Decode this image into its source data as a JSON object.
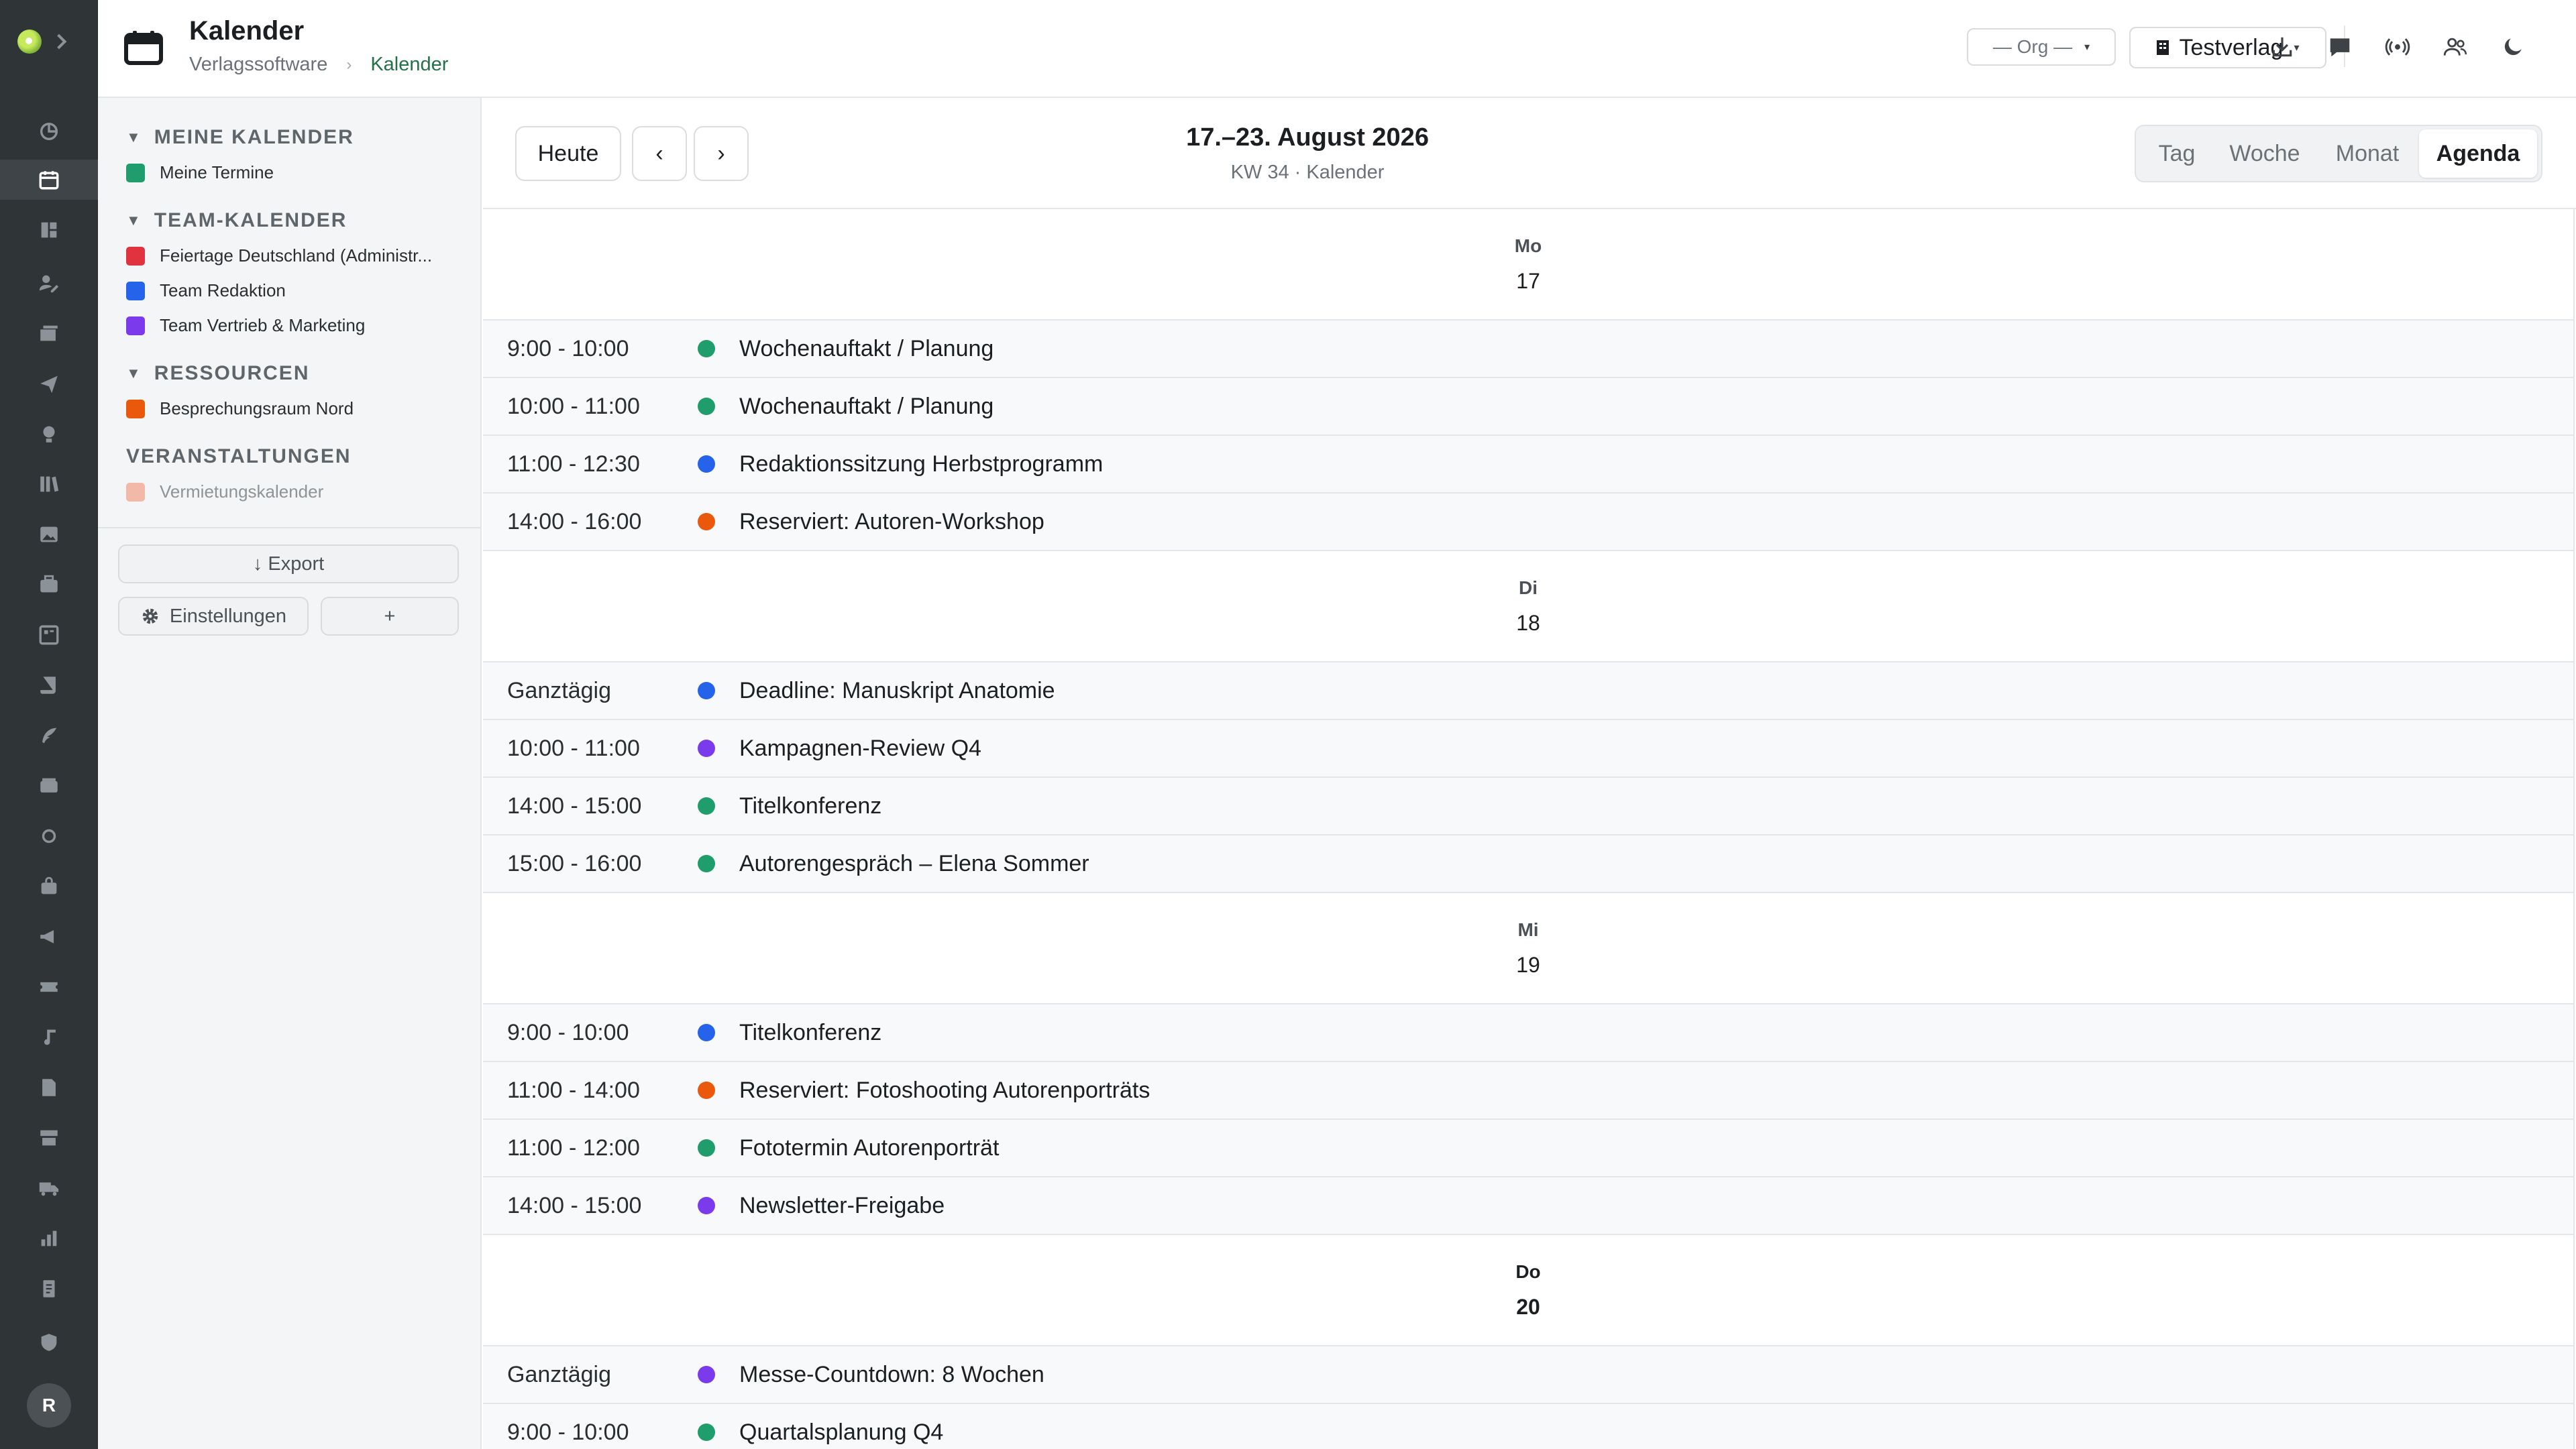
{
  "header": {
    "title": "Kalender",
    "breadcrumb_parent": "Verlagssoftware",
    "breadcrumb_sep": "›",
    "breadcrumb_current": "Kalender",
    "org_select": "— Org —",
    "tenant_select": "Testverlag",
    "caret": "▾",
    "icons": [
      "download-icon",
      "chat-icon",
      "broadcast-icon",
      "users-icon",
      "moon-icon"
    ]
  },
  "rail": {
    "avatar": "R",
    "icons": [
      "chart-pie-icon",
      "calendar-icon",
      "dashboard-icon",
      "user-edit-icon",
      "mail-stack-icon",
      "send-icon",
      "lightbulb-icon",
      "library-icon",
      "image-icon",
      "briefcase-icon",
      "board-icon",
      "scroll-icon",
      "feather-icon",
      "wallet-icon",
      "circle-icon",
      "bag-icon",
      "megaphone-icon",
      "ticket-icon",
      "music-icon",
      "file-icon",
      "store-icon",
      "truck-icon",
      "bar-chart-icon",
      "document-icon",
      "shield-icon"
    ]
  },
  "sidebar": {
    "collapse_glyph": "▼",
    "sections": [
      {
        "title": "MEINE KALENDER",
        "collapsible": true,
        "items": [
          {
            "label": "Meine Termine",
            "color": "#1f9d6c"
          }
        ]
      },
      {
        "title": "TEAM-KALENDER",
        "collapsible": true,
        "items": [
          {
            "label": "Feiertage Deutschland (Administr...",
            "color": "#e0323f"
          },
          {
            "label": "Team Redaktion",
            "color": "#2563eb"
          },
          {
            "label": "Team Vertrieb & Marketing",
            "color": "#7c3aed"
          }
        ]
      },
      {
        "title": "RESSOURCEN",
        "collapsible": true,
        "items": [
          {
            "label": "Besprechungsraum Nord",
            "color": "#ea580c"
          }
        ]
      },
      {
        "title": "VERANSTALTUNGEN",
        "collapsible": false,
        "items": [
          {
            "label": "Vermietungskalender",
            "color": "#f2b8a8"
          }
        ]
      }
    ],
    "export_label": "↓ Export",
    "settings_label": "Einstellungen",
    "add_label": "+"
  },
  "toolbar": {
    "today_label": "Heute",
    "prev_label": "‹",
    "next_label": "›",
    "range_title": "17.–23. August 2026",
    "range_subtitle": "KW 34 · Kalender",
    "views": [
      "Tag",
      "Woche",
      "Monat",
      "Agenda"
    ],
    "active_view": "Agenda"
  },
  "agenda": {
    "days": [
      {
        "dow": "Mo",
        "day": "17",
        "today": false,
        "events": [
          {
            "time": "9:00 - 10:00",
            "title": "Wochenauftakt / Planung",
            "color": "#1f9d6c"
          },
          {
            "time": "10:00 - 11:00",
            "title": "Wochenauftakt / Planung",
            "color": "#1f9d6c"
          },
          {
            "time": "11:00 - 12:30",
            "title": "Redaktionssitzung Herbstprogramm",
            "color": "#2563eb"
          },
          {
            "time": "14:00 - 16:00",
            "title": "Reserviert: Autoren-Workshop",
            "color": "#ea580c"
          }
        ]
      },
      {
        "dow": "Di",
        "day": "18",
        "today": false,
        "events": [
          {
            "time": "Ganztägig",
            "title": "Deadline: Manuskript Anatomie",
            "color": "#2563eb"
          },
          {
            "time": "10:00 - 11:00",
            "title": "Kampagnen-Review Q4",
            "color": "#7c3aed"
          },
          {
            "time": "14:00 - 15:00",
            "title": "Titelkonferenz",
            "color": "#1f9d6c"
          },
          {
            "time": "15:00 - 16:00",
            "title": "Autorengespräch – Elena Sommer",
            "color": "#1f9d6c"
          }
        ]
      },
      {
        "dow": "Mi",
        "day": "19",
        "today": false,
        "events": [
          {
            "time": "9:00 - 10:00",
            "title": "Titelkonferenz",
            "color": "#2563eb"
          },
          {
            "time": "11:00 - 14:00",
            "title": "Reserviert: Fotoshooting Autorenporträts",
            "color": "#ea580c"
          },
          {
            "time": "11:00 - 12:00",
            "title": "Fototermin Autorenporträt",
            "color": "#1f9d6c"
          },
          {
            "time": "14:00 - 15:00",
            "title": "Newsletter-Freigabe",
            "color": "#7c3aed"
          }
        ]
      },
      {
        "dow": "Do",
        "day": "20",
        "today": true,
        "events": [
          {
            "time": "Ganztägig",
            "title": "Messe-Countdown: 8 Wochen",
            "color": "#7c3aed"
          },
          {
            "time": "9:00 - 10:00",
            "title": "Quartalsplanung Q4",
            "color": "#1f9d6c"
          }
        ]
      }
    ]
  }
}
